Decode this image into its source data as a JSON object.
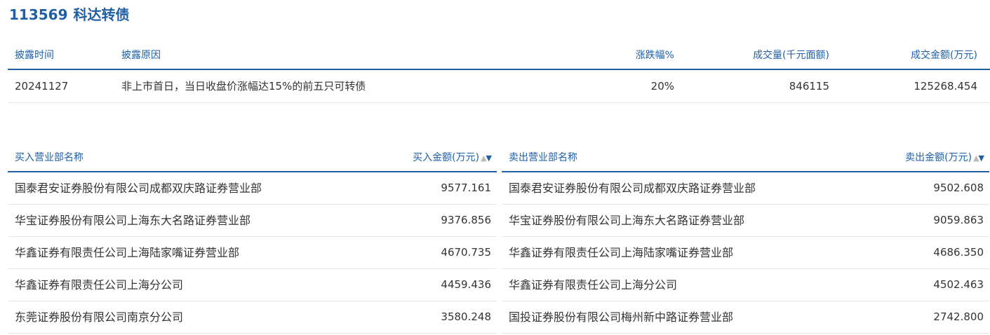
{
  "header": {
    "code": "113569",
    "name": "科达转债"
  },
  "summary": {
    "columns": [
      "披露时间",
      "披露原因",
      "涨跌幅%",
      "成交量(千元面额)",
      "成交金额(万元)"
    ],
    "row": {
      "time": "20241127",
      "reason": "非上市首日，当日收盘价涨幅达15%的前五只可转债",
      "change": "20%",
      "volume": "846115",
      "amount": "125268.454"
    }
  },
  "buy": {
    "name_header": "买入营业部名称",
    "amount_header": "买入金额(万元)",
    "sort_up": "▲",
    "sort_down": "▼",
    "rows": [
      {
        "name": "国泰君安证券股份有限公司成都双庆路证券营业部",
        "amount": "9577.161"
      },
      {
        "name": "华宝证券股份有限公司上海东大名路证券营业部",
        "amount": "9376.856"
      },
      {
        "name": "华鑫证券有限责任公司上海陆家嘴证券营业部",
        "amount": "4670.735"
      },
      {
        "name": "华鑫证券有限责任公司上海分公司",
        "amount": "4459.436"
      },
      {
        "name": "东莞证券股份有限公司南京分公司",
        "amount": "3580.248"
      }
    ]
  },
  "sell": {
    "name_header": "卖出营业部名称",
    "amount_header": "卖出金额(万元)",
    "sort_up": "▲",
    "sort_down": "▼",
    "rows": [
      {
        "name": "国泰君安证券股份有限公司成都双庆路证券营业部",
        "amount": "9502.608"
      },
      {
        "name": "华宝证券股份有限公司上海东大名路证券营业部",
        "amount": "9059.863"
      },
      {
        "name": "华鑫证券有限责任公司上海陆家嘴证券营业部",
        "amount": "4686.350"
      },
      {
        "name": "华鑫证券有限责任公司上海分公司",
        "amount": "4502.463"
      },
      {
        "name": "国投证券股份有限公司梅州新中路证券营业部",
        "amount": "2742.800"
      }
    ]
  },
  "colors": {
    "accent": "#1f5fa6",
    "text": "#333333",
    "divider": "#e5e5e5",
    "sort_inactive": "#b9b9b9"
  }
}
